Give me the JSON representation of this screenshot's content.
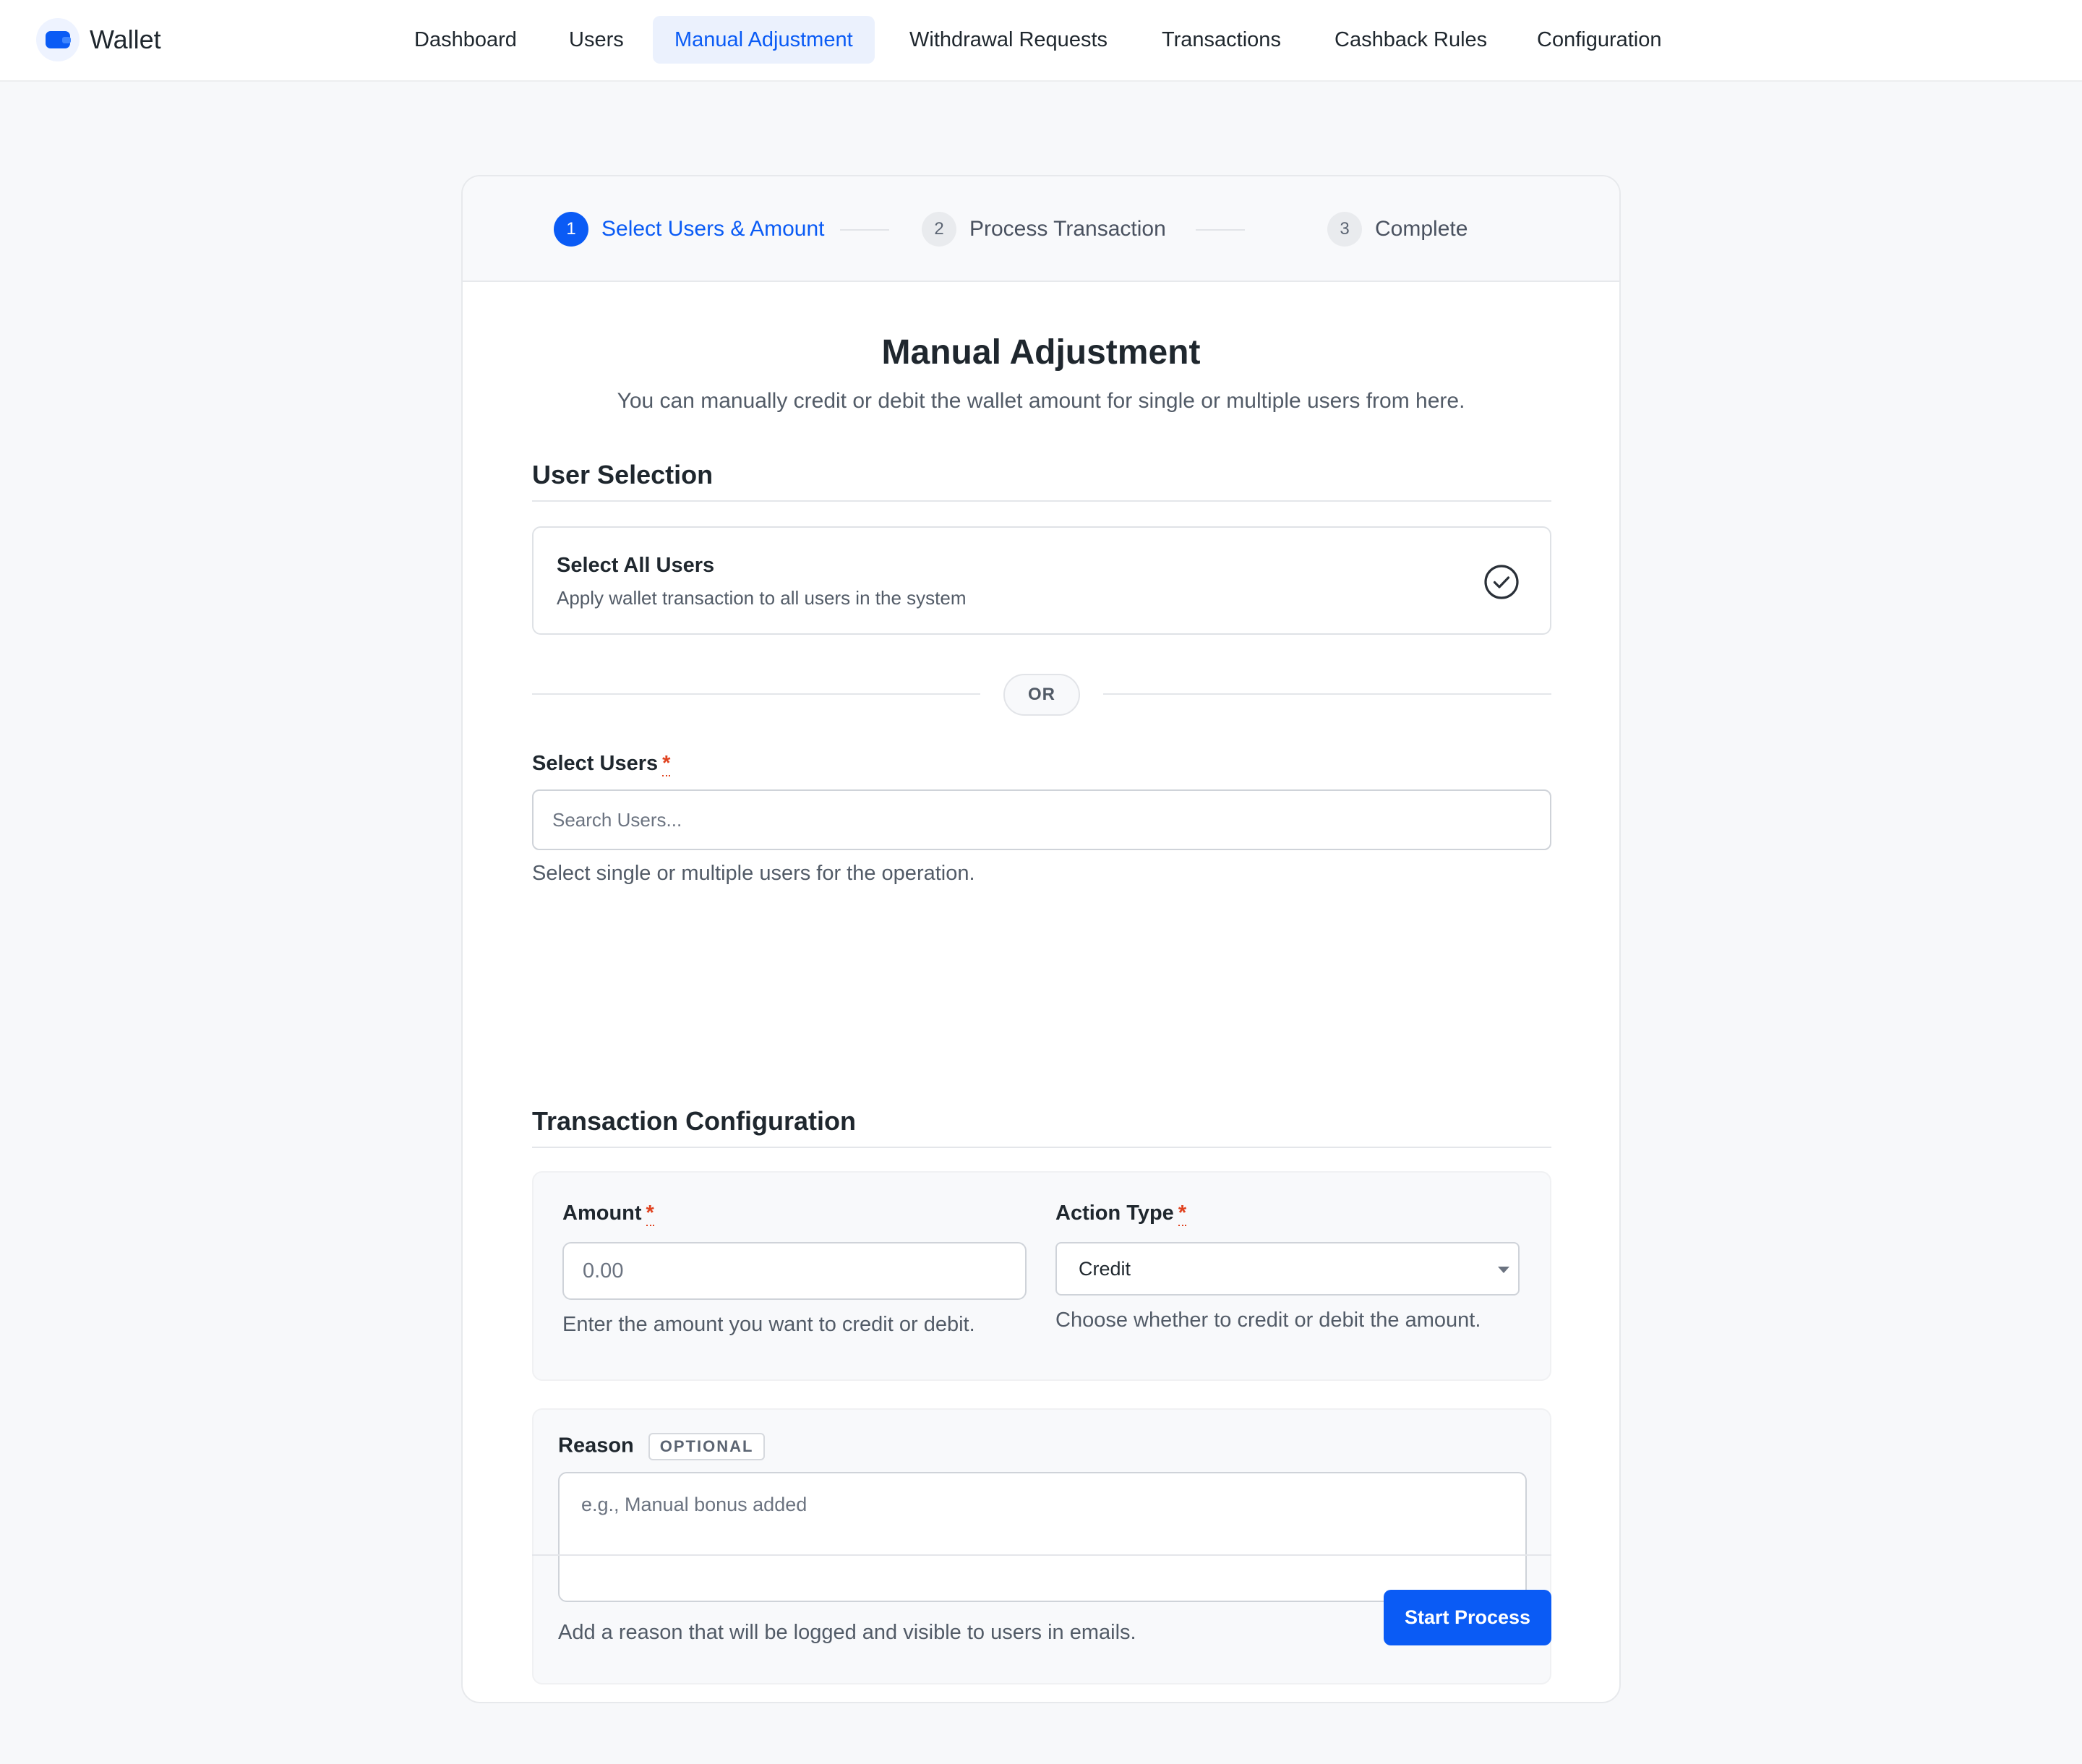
{
  "app": {
    "name": "Wallet",
    "logo_icon": "wallet-icon",
    "accent": "#0a5bf5"
  },
  "nav": {
    "items": [
      {
        "label": "Dashboard",
        "active": false
      },
      {
        "label": "Users",
        "active": false
      },
      {
        "label": "Manual Adjustment",
        "active": true
      },
      {
        "label": "Withdrawal Requests",
        "active": false
      },
      {
        "label": "Transactions",
        "active": false
      },
      {
        "label": "Cashback Rules",
        "active": false
      },
      {
        "label": "Configuration",
        "active": false
      }
    ]
  },
  "stepper": {
    "steps": [
      {
        "number": "1",
        "label": "Select Users & Amount",
        "active": true
      },
      {
        "number": "2",
        "label": "Process Transaction",
        "active": false
      },
      {
        "number": "3",
        "label": "Complete",
        "active": false
      }
    ]
  },
  "page": {
    "title": "Manual Adjustment",
    "subtitle": "You can manually credit or debit the wallet amount for single or multiple users from here."
  },
  "user_selection": {
    "heading": "User Selection",
    "select_all": {
      "title": "Select All Users",
      "description": "Apply wallet transaction to all users in the system",
      "icon": "check-circle-icon"
    },
    "divider_label": "OR",
    "select_users": {
      "label": "Select Users",
      "required_mark": "*",
      "placeholder": "Search Users...",
      "value": "",
      "help": "Select single or multiple users for the operation."
    }
  },
  "transaction_config": {
    "heading": "Transaction Configuration",
    "amount": {
      "label": "Amount",
      "required_mark": "*",
      "placeholder": "0.00",
      "value": "",
      "help": "Enter the amount you want to credit or debit."
    },
    "action_type": {
      "label": "Action Type",
      "required_mark": "*",
      "selected": "Credit",
      "help": "Choose whether to credit or debit the amount."
    },
    "reason": {
      "label": "Reason",
      "badge": "OPTIONAL",
      "placeholder": "e.g., Manual bonus added",
      "value": "",
      "help": "Add a reason that will be logged and visible to users in emails."
    }
  },
  "actions": {
    "start_label": "Start Process"
  }
}
